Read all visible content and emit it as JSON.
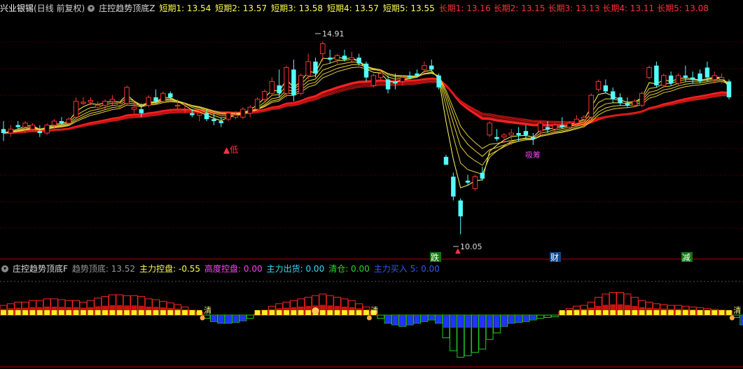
{
  "main_legend": {
    "stock_name": "兴业银锡",
    "period": "(日线 前复权)",
    "indicator": "庄控趋势顶底Z",
    "collapse_icon": "chevron-down-icon",
    "short_terms": [
      {
        "label": "短期1: 13.54"
      },
      {
        "label": "短期2: 13.57"
      },
      {
        "label": "短期3: 13.58"
      },
      {
        "label": "短期4: 13.57"
      },
      {
        "label": "短期5: 13.55"
      }
    ],
    "long_terms": [
      {
        "label": "长期1: 13.16"
      },
      {
        "label": "长期2: 13.15"
      },
      {
        "label": "长期3: 13.13"
      },
      {
        "label": "长期4: 13.11"
      },
      {
        "label": "长期5: 13.08"
      }
    ],
    "colors": {
      "short": "#ffff55",
      "long": "#ff3333"
    }
  },
  "annotations": {
    "high_label": "14.91",
    "low_label": "10.05",
    "low_signal": "▲低",
    "pink_signal": "吸筹",
    "tag_fall": "跌",
    "tag_finance": "财",
    "tag_reduce": "减"
  },
  "sub_legend": {
    "indicator": "庄控趋势顶底F",
    "trend_label": "趋势顶底: 13.52",
    "main_control": "主力控盘: -0.55",
    "high_control": "高度控盘: 0.00",
    "main_sell": "主力出货: 0.00",
    "clear": "清仓: 0.00",
    "main_buy": "主力买入 5: 0.00",
    "clear_marker": "清",
    "colors": {
      "main_control": "#ffff55",
      "high_control": "#ff44ff",
      "main_sell": "#33ddff",
      "clear": "#22dd22",
      "main_buy": "#3355ff"
    }
  },
  "chart_data": [
    {
      "type": "candlestick",
      "title": "兴业银锡 (日线 前复权)",
      "ylim": [
        9.6,
        15.6
      ],
      "annotated_high": 14.91,
      "annotated_low": 10.05,
      "candles": [
        [
          12.7,
          12.9,
          12.4,
          12.6
        ],
        [
          12.6,
          12.8,
          12.5,
          12.7
        ],
        [
          12.8,
          12.9,
          12.7,
          12.75
        ],
        [
          12.75,
          12.9,
          12.6,
          12.85
        ],
        [
          12.7,
          12.85,
          12.65,
          12.8
        ],
        [
          12.65,
          12.8,
          12.5,
          12.6
        ],
        [
          12.6,
          12.85,
          12.55,
          12.8
        ],
        [
          12.8,
          12.95,
          12.7,
          12.9
        ],
        [
          12.9,
          13.0,
          12.8,
          12.85
        ],
        [
          12.85,
          13.0,
          12.8,
          12.95
        ],
        [
          13.0,
          13.5,
          12.95,
          13.4
        ],
        [
          13.35,
          13.5,
          13.3,
          13.38
        ],
        [
          13.38,
          13.5,
          13.3,
          13.42
        ],
        [
          13.25,
          13.4,
          13.2,
          13.3
        ],
        [
          13.3,
          13.45,
          13.2,
          13.4
        ],
        [
          13.4,
          13.55,
          13.3,
          13.45
        ],
        [
          13.3,
          13.4,
          13.2,
          13.35
        ],
        [
          13.35,
          13.8,
          13.3,
          13.75
        ],
        [
          13.2,
          13.4,
          13.1,
          13.25
        ],
        [
          13.2,
          13.35,
          13.0,
          13.1
        ],
        [
          13.3,
          13.55,
          13.25,
          13.5
        ],
        [
          13.5,
          13.7,
          13.35,
          13.4
        ],
        [
          13.4,
          13.65,
          13.35,
          13.6
        ],
        [
          13.6,
          13.65,
          13.45,
          13.5
        ],
        [
          13.3,
          13.45,
          13.2,
          13.3
        ],
        [
          13.2,
          13.35,
          13.1,
          13.2
        ],
        [
          13.1,
          13.2,
          13.0,
          13.05
        ],
        [
          13.05,
          13.15,
          12.9,
          13.1
        ],
        [
          13.1,
          13.2,
          12.9,
          12.95
        ],
        [
          12.95,
          13.1,
          12.8,
          12.9
        ],
        [
          12.9,
          13.0,
          12.75,
          12.85
        ],
        [
          12.95,
          13.15,
          12.9,
          13.1
        ],
        [
          13.0,
          13.15,
          12.95,
          13.05
        ],
        [
          13.0,
          13.25,
          12.95,
          13.2
        ],
        [
          13.1,
          13.3,
          13.0,
          13.25
        ],
        [
          13.2,
          13.5,
          13.15,
          13.45
        ],
        [
          13.45,
          13.7,
          13.4,
          13.65
        ],
        [
          13.6,
          14.0,
          13.55,
          13.9
        ],
        [
          13.8,
          14.2,
          13.5,
          13.6
        ],
        [
          13.6,
          14.3,
          13.5,
          14.25
        ],
        [
          14.2,
          14.45,
          13.4,
          13.55
        ],
        [
          13.6,
          14.1,
          13.55,
          14.05
        ],
        [
          14.05,
          14.6,
          13.95,
          14.4
        ],
        [
          14.4,
          14.5,
          14.0,
          14.1
        ],
        [
          14.6,
          14.91,
          14.4,
          14.85
        ],
        [
          14.5,
          14.7,
          14.35,
          14.45
        ],
        [
          14.45,
          14.6,
          14.35,
          14.55
        ],
        [
          14.55,
          14.7,
          14.4,
          14.45
        ],
        [
          14.45,
          14.65,
          14.4,
          14.5
        ],
        [
          14.5,
          14.6,
          14.3,
          14.35
        ],
        [
          14.35,
          14.4,
          13.9,
          14.0
        ],
        [
          13.8,
          14.1,
          13.75,
          14.05
        ],
        [
          14.0,
          14.2,
          13.9,
          14.1
        ],
        [
          13.95,
          14.05,
          13.6,
          13.7
        ],
        [
          13.9,
          14.1,
          13.7,
          13.85
        ],
        [
          13.9,
          14.05,
          13.8,
          14.0
        ],
        [
          14.05,
          14.15,
          13.95,
          14.0
        ],
        [
          14.1,
          14.2,
          14.0,
          14.05
        ],
        [
          14.2,
          14.4,
          14.1,
          14.3
        ],
        [
          14.3,
          14.45,
          14.15,
          14.2
        ],
        [
          14.05,
          14.1,
          13.7,
          13.75
        ],
        [
          12.0,
          12.05,
          11.8,
          11.8
        ],
        [
          11.5,
          11.6,
          10.9,
          11.0
        ],
        [
          10.9,
          10.95,
          10.05,
          10.5
        ],
        [
          11.4,
          11.55,
          11.3,
          11.35
        ],
        [
          11.2,
          11.55,
          11.15,
          11.5
        ],
        [
          11.6,
          11.75,
          11.4,
          11.45
        ],
        [
          12.55,
          12.9,
          12.5,
          12.85
        ],
        [
          12.5,
          12.7,
          12.4,
          12.45
        ],
        [
          12.5,
          12.6,
          12.35,
          12.55
        ],
        [
          12.55,
          12.7,
          12.3,
          12.6
        ],
        [
          12.6,
          12.75,
          12.4,
          12.55
        ],
        [
          12.65,
          12.8,
          12.45,
          12.55
        ],
        [
          12.5,
          12.6,
          12.3,
          12.45
        ],
        [
          12.65,
          12.9,
          12.55,
          12.85
        ],
        [
          12.75,
          12.9,
          12.6,
          12.7
        ],
        [
          12.7,
          12.85,
          12.6,
          12.8
        ],
        [
          12.8,
          13.0,
          12.7,
          12.75
        ],
        [
          12.75,
          12.9,
          12.7,
          12.85
        ],
        [
          12.85,
          13.05,
          12.8,
          12.95
        ],
        [
          12.95,
          13.05,
          12.85,
          13.0
        ],
        [
          13.0,
          13.6,
          12.95,
          13.55
        ],
        [
          13.7,
          13.95,
          13.65,
          13.9
        ],
        [
          13.8,
          13.95,
          13.6,
          13.65
        ],
        [
          13.65,
          13.75,
          13.35,
          13.45
        ],
        [
          13.5,
          13.6,
          13.3,
          13.35
        ],
        [
          13.35,
          13.5,
          13.25,
          13.3
        ],
        [
          13.3,
          13.45,
          13.25,
          13.4
        ],
        [
          13.3,
          13.65,
          13.25,
          13.6
        ],
        [
          14.0,
          14.3,
          13.95,
          14.25
        ],
        [
          14.3,
          14.4,
          13.75,
          13.8
        ],
        [
          13.8,
          14.1,
          13.75,
          14.05
        ],
        [
          14.05,
          14.15,
          13.8,
          13.85
        ],
        [
          13.85,
          14.1,
          13.8,
          14.05
        ],
        [
          14.05,
          14.3,
          13.9,
          14.0
        ],
        [
          14.0,
          14.15,
          13.85,
          13.95
        ],
        [
          14.1,
          14.2,
          13.85,
          13.9
        ],
        [
          14.25,
          14.4,
          13.9,
          14.0
        ],
        [
          13.95,
          14.15,
          13.85,
          14.05
        ],
        [
          13.95,
          14.1,
          13.85,
          14.0
        ],
        [
          13.9,
          13.95,
          13.45,
          13.5
        ]
      ],
      "series": [
        {
          "name": "短期1",
          "last": 13.54
        },
        {
          "name": "短期2",
          "last": 13.57
        },
        {
          "name": "短期3",
          "last": 13.58
        },
        {
          "name": "短期4",
          "last": 13.57
        },
        {
          "name": "短期5",
          "last": 13.55
        },
        {
          "name": "长期1",
          "last": 13.16
        },
        {
          "name": "长期2",
          "last": 13.15
        },
        {
          "name": "长期3",
          "last": 13.13
        },
        {
          "name": "长期4",
          "last": 13.11
        },
        {
          "name": "长期5",
          "last": 13.08
        }
      ]
    },
    {
      "type": "bar",
      "title": "庄控趋势顶底F",
      "ylim": [
        -0.6,
        0.35
      ],
      "values": [
        0.12,
        0.14,
        0.16,
        0.16,
        0.18,
        0.18,
        0.2,
        0.2,
        0.19,
        0.18,
        0.18,
        0.16,
        0.18,
        0.21,
        0.23,
        0.25,
        0.25,
        0.24,
        0.24,
        0.23,
        0.2,
        0.19,
        0.17,
        0.15,
        0.13,
        0.1,
        0.06,
        0.03,
        -0.04,
        -0.08,
        -0.1,
        -0.1,
        -0.09,
        -0.07,
        -0.04,
        0.01,
        0.06,
        0.11,
        0.14,
        0.16,
        0.18,
        0.2,
        0.22,
        0.24,
        0.26,
        0.24,
        0.22,
        0.2,
        0.18,
        0.14,
        0.1,
        0.04,
        -0.04,
        -0.1,
        -0.12,
        -0.14,
        -0.12,
        -0.1,
        -0.08,
        -0.06,
        -0.1,
        -0.28,
        -0.44,
        -0.52,
        -0.5,
        -0.46,
        -0.42,
        -0.3,
        -0.22,
        -0.14,
        -0.1,
        -0.09,
        -0.08,
        -0.06,
        -0.04,
        -0.03,
        -0.02,
        0.04,
        0.08,
        0.11,
        0.12,
        0.16,
        0.22,
        0.26,
        0.28,
        0.28,
        0.26,
        0.22,
        0.18,
        0.16,
        0.14,
        0.13,
        0.12,
        0.12,
        0.11,
        0.1,
        0.09,
        0.08,
        0.07,
        0.06,
        0.05,
        -0.03,
        -0.12
      ]
    }
  ]
}
